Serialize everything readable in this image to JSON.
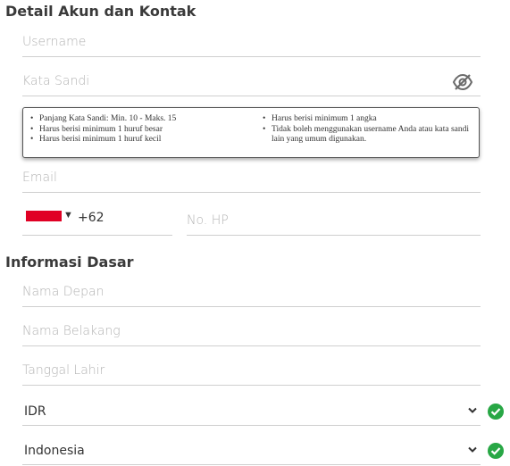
{
  "account": {
    "title": "Detail Akun dan Kontak",
    "username_placeholder": "Username",
    "password_placeholder": "Kata Sandi",
    "email_placeholder": "Email",
    "phone_code": "+62",
    "phone_placeholder": "No. HP",
    "password_rules_left": [
      "Panjang Kata Sandi: Min. 10 - Maks. 15",
      "Harus berisi minimum 1 huruf besar",
      "Harus berisi minimum 1 huruf kecil"
    ],
    "password_rules_right": [
      "Harus berisi minimum 1 angka",
      "Tidak boleh menggunakan username Anda atau kata sandi lain yang umum digunakan."
    ]
  },
  "basic": {
    "title": "Informasi Dasar",
    "first_name_placeholder": "Nama Depan",
    "last_name_placeholder": "Nama Belakang",
    "dob_placeholder": "Tanggal Lahir",
    "currency": "IDR",
    "country": "Indonesia"
  },
  "icons": {
    "password_toggle": "eye-slash-icon",
    "dropdown": "chevron-down-icon",
    "valid": "check-circle-icon"
  },
  "colors": {
    "accent_green": "#28a745",
    "flag_red": "#e00024",
    "underline": "#cfcfcf"
  }
}
